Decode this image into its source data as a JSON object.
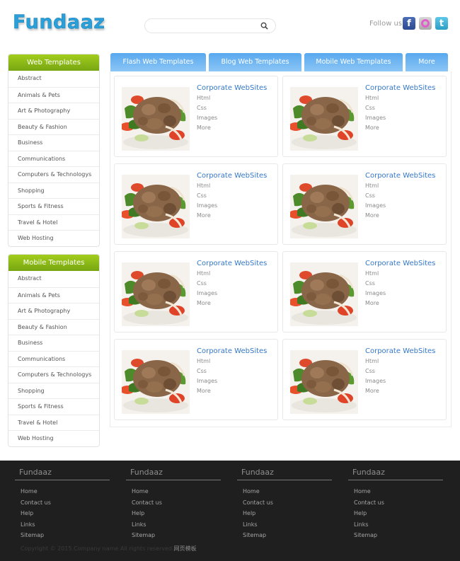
{
  "header": {
    "logo": "Fundaaz",
    "search_placeholder": "",
    "search_value": "",
    "search_icon": "search-icon",
    "follow_label": "Follow us",
    "social": [
      {
        "name": "facebook",
        "glyph": "f"
      },
      {
        "name": "flickr",
        "glyph": ""
      },
      {
        "name": "twitter",
        "glyph": "t"
      }
    ]
  },
  "sidebar_web": {
    "title": "Web Templates",
    "items": [
      "Abstract",
      "Animals & Pets",
      "Art & Photography",
      "Beauty & Fashion",
      "Business",
      "Communications",
      "Computers & Technologys",
      "Shopping",
      "Sports & Fitness",
      "Travel & Hotel",
      "Web Hosting"
    ]
  },
  "sidebar_mobile": {
    "title": "Mobile Templates",
    "items": [
      "Abstract",
      "Animals & Pets",
      "Art & Photography",
      "Beauty & Fashion",
      "Business",
      "Communications",
      "Computers & Technologys",
      "Shopping",
      "Sports & Fitness",
      "Travel & Hotel",
      "Web Hosting"
    ]
  },
  "tabs": [
    "Flash Web Templates",
    "Blog Web Templates",
    "Mobile Web Templates",
    "More"
  ],
  "cards": [
    {
      "title": "Corporate WebSites",
      "links": [
        "Html",
        "Css",
        "Images",
        "More"
      ]
    },
    {
      "title": "Corporate WebSites",
      "links": [
        "Html",
        "Css",
        "Images",
        "More"
      ]
    },
    {
      "title": "Corporate WebSites",
      "links": [
        "Html",
        "Css",
        "Images",
        "More"
      ]
    },
    {
      "title": "Corporate WebSites",
      "links": [
        "Html",
        "Css",
        "Images",
        "More"
      ]
    },
    {
      "title": "Corporate WebSites",
      "links": [
        "Html",
        "Css",
        "Images",
        "More"
      ]
    },
    {
      "title": "Corporate WebSites",
      "links": [
        "Html",
        "Css",
        "Images",
        "More"
      ]
    },
    {
      "title": "Corporate WebSites",
      "links": [
        "Html",
        "Css",
        "Images",
        "More"
      ]
    },
    {
      "title": "Corporate WebSites",
      "links": [
        "Html",
        "Css",
        "Images",
        "More"
      ]
    }
  ],
  "footer": {
    "columns": [
      {
        "title": "Fundaaz",
        "links": [
          "Home",
          "Contact us",
          "Help",
          "Links",
          "Sitemap"
        ]
      },
      {
        "title": "Fundaaz",
        "links": [
          "Home",
          "Contact us",
          "Help",
          "Links",
          "Sitemap"
        ]
      },
      {
        "title": "Fundaaz",
        "links": [
          "Home",
          "Contact us",
          "Help",
          "Links",
          "Sitemap"
        ]
      },
      {
        "title": "Fundaaz",
        "links": [
          "Home",
          "Contact us",
          "Help",
          "Links",
          "Sitemap"
        ]
      }
    ],
    "copyright": "Copyright © 2015.Company name All rights reserved.",
    "copyright_link": "网页模板"
  },
  "colors": {
    "brand": "#2a9fd8",
    "sidebar_header": "#8cba16",
    "tab": "#6fb4f2",
    "card_title": "#3478c8",
    "footer_bg": "#1f1f1f"
  }
}
